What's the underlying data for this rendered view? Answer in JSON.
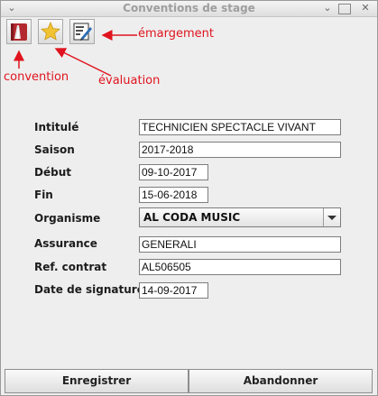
{
  "window": {
    "title": "Conventions de stage"
  },
  "titlebar_buttons": {
    "menu": "⌄",
    "minimize": "⌄",
    "close": "✕"
  },
  "toolbar": {
    "tools": [
      {
        "name": "convention",
        "icon": "book-icon"
      },
      {
        "name": "évaluation",
        "icon": "star-icon"
      },
      {
        "name": "émargement",
        "icon": "signature-icon"
      }
    ]
  },
  "annotations": {
    "convention": "convention",
    "evaluation": "évaluation",
    "emargement": "émargement",
    "color": "#e0141e"
  },
  "form": {
    "intitule": {
      "label": "Intitulé",
      "value": "TECHNICIEN SPECTACLE VIVANT"
    },
    "saison": {
      "label": "Saison",
      "value": "2017-2018"
    },
    "debut": {
      "label": "Début",
      "value": "09-10-2017"
    },
    "fin": {
      "label": "Fin",
      "value": "15-06-2018"
    },
    "organisme": {
      "label": "Organisme",
      "value": "AL CODA MUSIC"
    },
    "assurance": {
      "label": "Assurance",
      "value": "GENERALI"
    },
    "ref_contrat": {
      "label": "Ref. contrat",
      "value": "AL506505"
    },
    "date_signature": {
      "label": "Date de signature",
      "value": "14-09-2017"
    }
  },
  "buttons": {
    "save": "Enregistrer",
    "cancel": "Abandonner"
  }
}
